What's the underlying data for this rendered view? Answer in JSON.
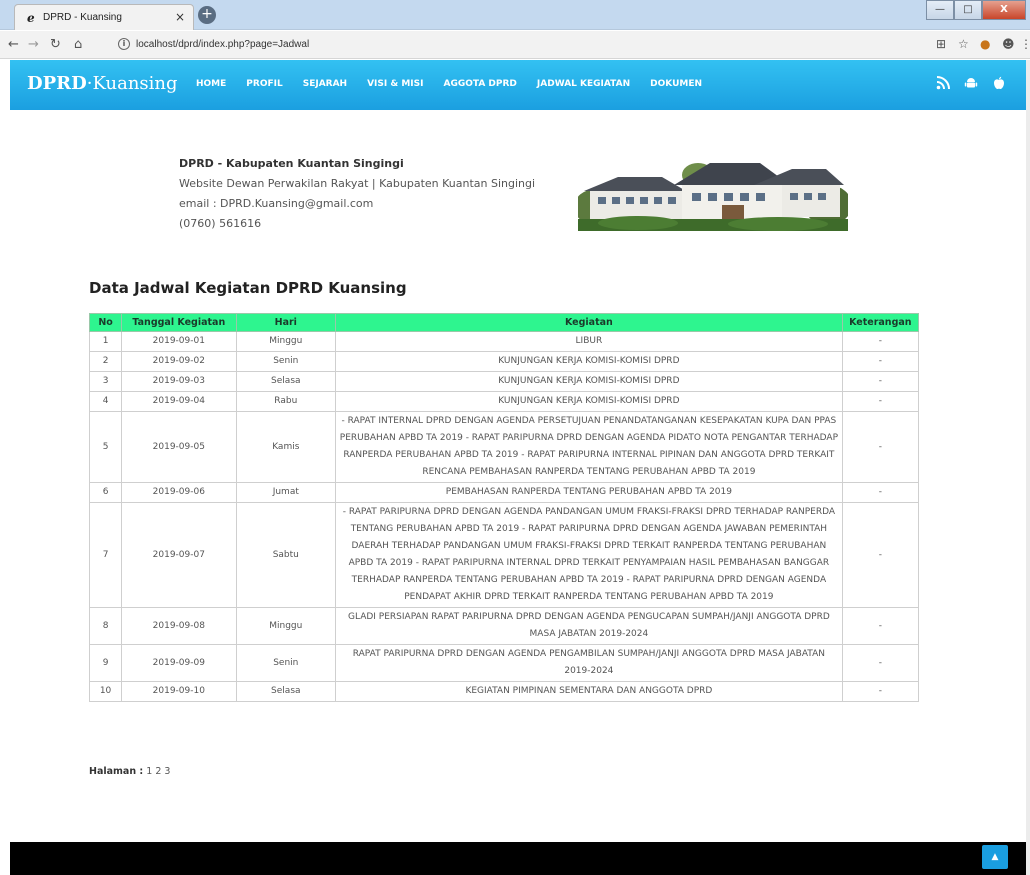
{
  "browser": {
    "tab_title": "DPRD - Kuansing",
    "tab_close": "×",
    "new_tab": "+",
    "url": "localhost/dprd/index.php?page=Jadwal",
    "win_min": "—",
    "win_max": "□",
    "win_close": "X"
  },
  "header": {
    "logo_bold": "DPRD",
    "logo_rest": "·Kuansing",
    "menu": [
      "HOME",
      "PROFIL",
      "SEJARAH",
      "VISI & MISI",
      "AGGOTA DPRD",
      "JADWAL KEGIATAN",
      "DOKUMEN"
    ]
  },
  "info": {
    "org": "DPRD - Kabupaten Kuantan Singingi",
    "website": "Website Dewan Perwakilan Rakyat | Kabupaten Kuantan Singingi",
    "email": "email : DPRD.Kuansing@gmail.com",
    "phone": "(0760) 561616"
  },
  "schedule": {
    "title": "Data Jadwal Kegiatan DPRD Kuansing",
    "headers": [
      "No",
      "Tanggal Kegiatan",
      "Hari",
      "Kegiatan",
      "Keterangan"
    ],
    "rows": [
      {
        "no": "1",
        "tanggal": "2019-09-01",
        "hari": "Minggu",
        "kegiatan": "LIBUR",
        "ket": "-"
      },
      {
        "no": "2",
        "tanggal": "2019-09-02",
        "hari": "Senin",
        "kegiatan": "KUNJUNGAN KERJA KOMISI-KOMISI DPRD",
        "ket": "-"
      },
      {
        "no": "3",
        "tanggal": "2019-09-03",
        "hari": "Selasa",
        "kegiatan": "KUNJUNGAN KERJA KOMISI-KOMISI DPRD",
        "ket": "-"
      },
      {
        "no": "4",
        "tanggal": "2019-09-04",
        "hari": "Rabu",
        "kegiatan": "KUNJUNGAN KERJA KOMISI-KOMISI DPRD",
        "ket": "-"
      },
      {
        "no": "5",
        "tanggal": "2019-09-05",
        "hari": "Kamis",
        "kegiatan": "- RAPAT INTERNAL DPRD DENGAN AGENDA PERSETUJUAN PENANDATANGANAN KESEPAKATAN KUPA DAN PPAS PERUBAHAN APBD TA 2019 - RAPAT PARIPURNA DPRD DENGAN AGENDA PIDATO NOTA PENGANTAR TERHADAP RANPERDA PERUBAHAN APBD TA 2019 - RAPAT PARIPURNA INTERNAL PIPINAN DAN ANGGOTA DPRD TERKAIT RENCANA PEMBAHASAN RANPERDA TENTANG PERUBAHAN APBD TA 2019",
        "ket": "-"
      },
      {
        "no": "6",
        "tanggal": "2019-09-06",
        "hari": "Jumat",
        "kegiatan": "PEMBAHASAN RANPERDA TENTANG PERUBAHAN APBD TA 2019",
        "ket": "-"
      },
      {
        "no": "7",
        "tanggal": "2019-09-07",
        "hari": "Sabtu",
        "kegiatan": "- RAPAT PARIPURNA DPRD DENGAN AGENDA PANDANGAN UMUM FRAKSI-FRAKSI DPRD TERHADAP RANPERDA TENTANG PERUBAHAN APBD TA 2019 - RAPAT PARIPURNA DPRD DENGAN AGENDA JAWABAN PEMERINTAH DAERAH TERHADAP PANDANGAN UMUM FRAKSI-FRAKSI DPRD TERKAIT RANPERDA TENTANG PERUBAHAN APBD TA 2019 - RAPAT PARIPURNA INTERNAL DPRD TERKAIT PENYAMPAIAN HASIL PEMBAHASAN BANGGAR TERHADAP RANPERDA TENTANG PERUBAHAN APBD TA 2019 - RAPAT PARIPURNA DPRD DENGAN AGENDA PENDAPAT AKHIR DPRD TERKAIT RANPERDA TENTANG PERUBAHAN APBD TA 2019",
        "ket": "-"
      },
      {
        "no": "8",
        "tanggal": "2019-09-08",
        "hari": "Minggu",
        "kegiatan": "GLADI PERSIAPAN RAPAT PARIPURNA DPRD DENGAN AGENDA PENGUCAPAN SUMPAH/JANJI ANGGOTA DPRD MASA JABATAN 2019-2024",
        "ket": "-"
      },
      {
        "no": "9",
        "tanggal": "2019-09-09",
        "hari": "Senin",
        "kegiatan": "RAPAT PARIPURNA DPRD DENGAN AGENDA PENGAMBILAN SUMPAH/JANJI ANGGOTA DPRD MASA JABATAN 2019-2024",
        "ket": "-"
      },
      {
        "no": "10",
        "tanggal": "2019-09-10",
        "hari": "Selasa",
        "kegiatan": "KEGIATAN PIMPINAN SEMENTARA DAN ANGGOTA DPRD",
        "ket": "-"
      }
    ]
  },
  "pager": {
    "label": "Halaman :",
    "pages": [
      "1",
      "2",
      "3"
    ]
  },
  "icons": {
    "accent": "#1b9fe0",
    "header_green": "#2ef58f",
    "to_top": "▲"
  }
}
